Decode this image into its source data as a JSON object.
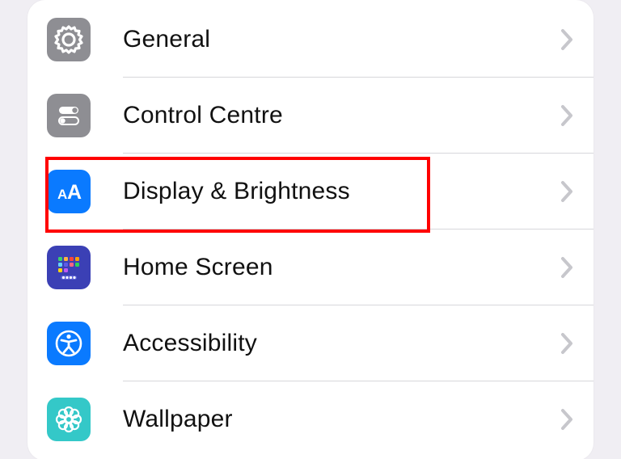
{
  "settings": {
    "items": [
      {
        "id": "general",
        "label": "General",
        "icon": "gear-icon",
        "tile": "tile-general"
      },
      {
        "id": "control_centre",
        "label": "Control Centre",
        "icon": "toggles-icon",
        "tile": "tile-control"
      },
      {
        "id": "display",
        "label": "Display & Brightness",
        "icon": "text-size-icon",
        "tile": "tile-display"
      },
      {
        "id": "home_screen",
        "label": "Home Screen",
        "icon": "home-grid-icon",
        "tile": "tile-home"
      },
      {
        "id": "accessibility",
        "label": "Accessibility",
        "icon": "accessibility-icon",
        "tile": "tile-access"
      },
      {
        "id": "wallpaper",
        "label": "Wallpaper",
        "icon": "flower-icon",
        "tile": "tile-wallpaper"
      }
    ],
    "highlighted_id": "display"
  },
  "colors": {
    "page_bg": "#f0eef3",
    "card_bg": "#ffffff",
    "separator": "#d7d7db",
    "chevron": "#c7c7cc",
    "highlight": "#ff0000",
    "text": "#111111"
  }
}
